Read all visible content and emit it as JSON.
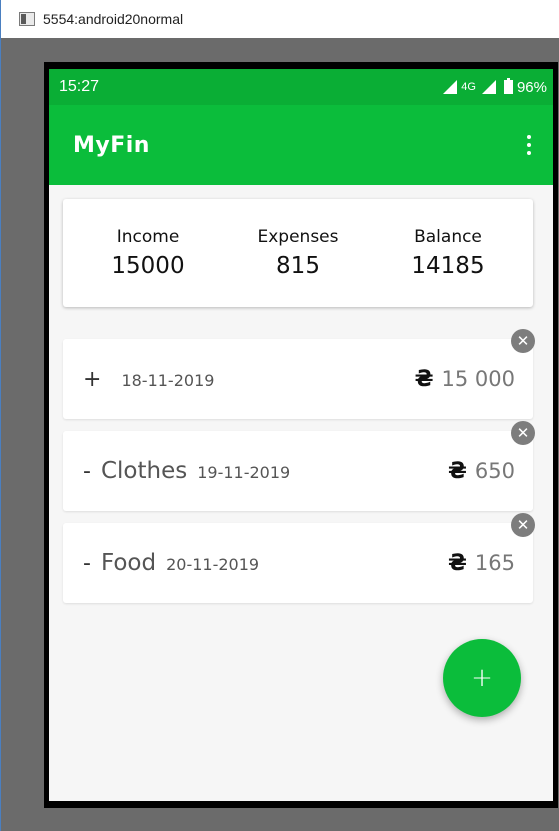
{
  "window": {
    "title": "5554:android20normal"
  },
  "statusbar": {
    "time": "15:27",
    "network": "4G",
    "battery": "96%"
  },
  "appbar": {
    "title": "MyFin"
  },
  "summary": {
    "income_label": "Income",
    "income_value": "15000",
    "expenses_label": "Expenses",
    "expenses_value": "815",
    "balance_label": "Balance",
    "balance_value": "14185"
  },
  "entries": [
    {
      "sign": "+",
      "category": "",
      "date": "18-11-2019",
      "currency": "₴",
      "amount": "15 000"
    },
    {
      "sign": "-",
      "category": "Clothes",
      "date": "19-11-2019",
      "currency": "₴",
      "amount": "650"
    },
    {
      "sign": "-",
      "category": "Food",
      "date": "20-11-2019",
      "currency": "₴",
      "amount": "165"
    }
  ],
  "icons": {
    "delete": "close-icon",
    "fab": "plus-icon",
    "menu": "more-vert-icon"
  },
  "fab": {
    "label": "+"
  },
  "colors": {
    "accent": "#0bbd3b",
    "statusbar": "#0aae35"
  }
}
